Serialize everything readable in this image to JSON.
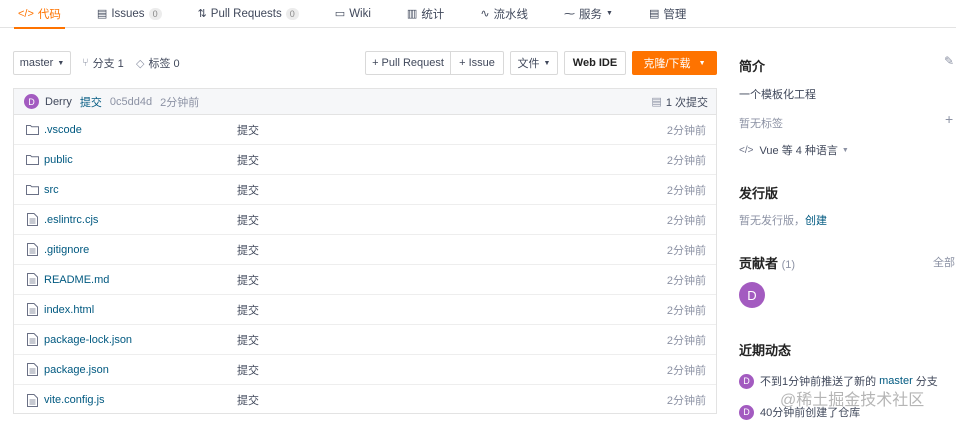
{
  "nav": {
    "tabs": [
      {
        "icon": "</>",
        "label": "代码"
      },
      {
        "icon": "▤",
        "label": "Issues",
        "count": "0"
      },
      {
        "icon": "⇅",
        "label": "Pull Requests",
        "count": "0"
      },
      {
        "icon": "▭",
        "label": "Wiki"
      },
      {
        "icon": "▥",
        "label": "统计"
      },
      {
        "icon": "∿",
        "label": "流水线"
      },
      {
        "icon": "⁓",
        "label": "服务"
      },
      {
        "icon": "▤",
        "label": "管理"
      }
    ]
  },
  "toolbar": {
    "branch": "master",
    "branches": "分支 1",
    "tags": "标签 0",
    "pull_request": "+ Pull Request",
    "issue": "+ Issue",
    "file": "文件",
    "web_ide": "Web IDE",
    "clone": "克隆/下载"
  },
  "commit": {
    "avatar": "D",
    "author": "Derry",
    "message": "提交",
    "sha": "0c5dd4d",
    "time": "2分钟前",
    "count": "1 次提交"
  },
  "files": [
    {
      "type": "folder",
      "name": ".vscode",
      "message": "提交",
      "time": "2分钟前"
    },
    {
      "type": "folder",
      "name": "public",
      "message": "提交",
      "time": "2分钟前"
    },
    {
      "type": "folder",
      "name": "src",
      "message": "提交",
      "time": "2分钟前"
    },
    {
      "type": "file",
      "name": ".eslintrc.cjs",
      "message": "提交",
      "time": "2分钟前"
    },
    {
      "type": "file",
      "name": ".gitignore",
      "message": "提交",
      "time": "2分钟前"
    },
    {
      "type": "file",
      "name": "README.md",
      "message": "提交",
      "time": "2分钟前"
    },
    {
      "type": "file",
      "name": "index.html",
      "message": "提交",
      "time": "2分钟前"
    },
    {
      "type": "file",
      "name": "package-lock.json",
      "message": "提交",
      "time": "2分钟前"
    },
    {
      "type": "file",
      "name": "package.json",
      "message": "提交",
      "time": "2分钟前"
    },
    {
      "type": "file",
      "name": "vite.config.js",
      "message": "提交",
      "time": "2分钟前"
    }
  ],
  "sidebar": {
    "intro_title": "简介",
    "intro_text": "一个模板化工程",
    "no_tags": "暂无标签",
    "languages": "Vue 等 4 种语言",
    "release_title": "发行版",
    "no_release": "暂无发行版，",
    "create": "创建",
    "contributors_title": "贡献者",
    "contributors_count": "(1)",
    "all": "全部",
    "contributor_avatar": "D",
    "activity_title": "近期动态",
    "activity_1_prefix": "不到1分钟前推送了新的",
    "activity_1_branch": "master",
    "activity_1_suffix": "分支",
    "activity_2": "40分钟前创建了仓库"
  },
  "watermark": "@稀土掘金技术社区",
  "colors": {
    "accent": "#fe7300",
    "link": "#005980",
    "avatar": "#a35bc0"
  }
}
